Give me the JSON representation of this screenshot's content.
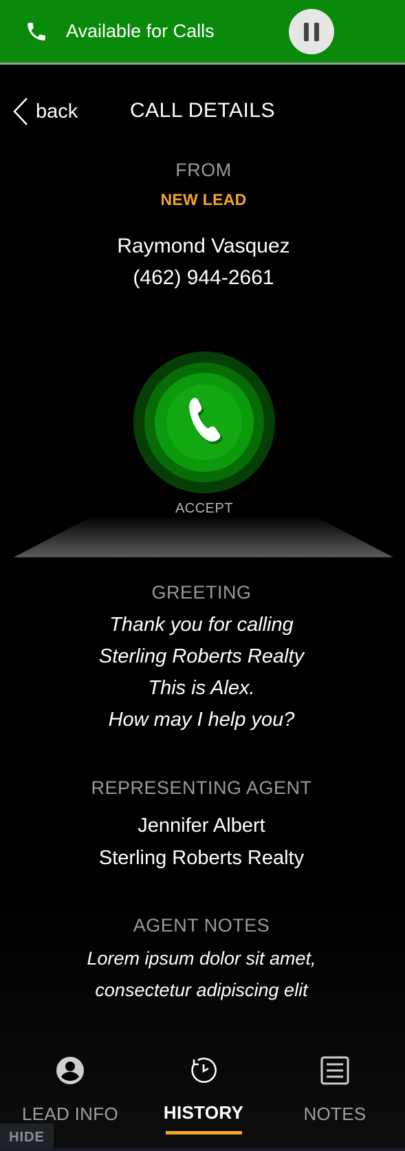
{
  "status_bar": {
    "text": "Available for Calls",
    "icon": "phone-icon",
    "pause_icon": "pause-icon",
    "color": "#0a8a0a"
  },
  "header": {
    "back_label": "back",
    "title": "CALL DETAILS"
  },
  "caller": {
    "from_label": "FROM",
    "lead_status": "NEW LEAD",
    "name": "Raymond Vasquez",
    "phone": "(462) 944-2661"
  },
  "accept": {
    "label": "ACCEPT",
    "icon": "phone-icon",
    "color": "#12a812"
  },
  "greeting": {
    "label": "GREETING",
    "lines": [
      "Thank you for calling",
      "Sterling Roberts Realty",
      "This is Alex.",
      "How may I help you?"
    ]
  },
  "agent": {
    "label": "REPRESENTING AGENT",
    "name": "Jennifer Albert",
    "company": "Sterling Roberts Realty"
  },
  "notes": {
    "label": "AGENT NOTES",
    "lines": [
      "Lorem ipsum dolor sit amet,",
      "consectetur adipiscing elit"
    ]
  },
  "nav": {
    "tabs": [
      {
        "label": "LEAD INFO",
        "icon": "user-circle-icon"
      },
      {
        "label": "HISTORY",
        "icon": "clock-history-icon",
        "active": true
      },
      {
        "label": "NOTES",
        "icon": "notes-icon"
      }
    ],
    "hide_label": "HIDE"
  },
  "colors": {
    "accent": "#f5a623",
    "background": "#000000"
  }
}
